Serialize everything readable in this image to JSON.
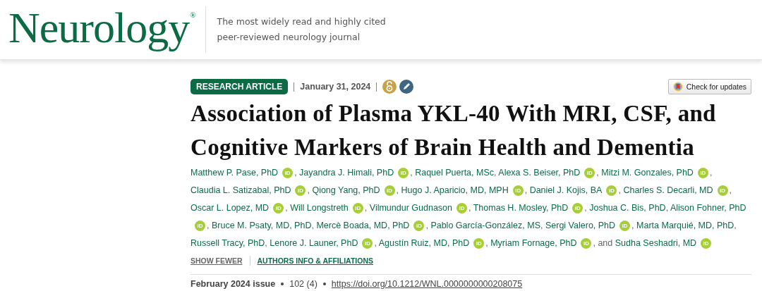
{
  "header": {
    "logo": "Neurology",
    "registered_mark": "®",
    "tagline": "The most widely read and highly cited peer-reviewed neurology journal"
  },
  "article": {
    "badge": "RESEARCH ARTICLE",
    "date": "January 31, 2024",
    "open_access": true,
    "editorial": true,
    "updates_button": "Check for updates",
    "title": "Association of Plasma YKL-40 With MRI, CSF, and Cognitive Markers of Brain Health and Dementia",
    "authors": [
      {
        "name": "Matthew P. Pase, PhD",
        "orcid": "iD",
        "sep": ","
      },
      {
        "name": "Jayandra J. Himali, PhD",
        "orcid": "iD",
        "sep": ","
      },
      {
        "name": "Raquel Puerta, MSc",
        "sep": ","
      },
      {
        "name": "Alexa S. Beiser, PhD",
        "orcid": "iD",
        "sep": ","
      },
      {
        "name": "Mitzi M. Gonzales, PhD",
        "orcid": "iD",
        "sep": ","
      },
      {
        "name": "Claudia L. Satizabal, PhD",
        "orcid": "iD",
        "sep": ","
      },
      {
        "name": "Qiong Yang, PhD",
        "orcid": "iD",
        "sep": ","
      },
      {
        "name": "Hugo J. Aparicio, MD, MPH",
        "orcid": "iD",
        "sep": ","
      },
      {
        "name": "Daniel J. Kojis, BA",
        "orcid": "iD",
        "sep": ","
      },
      {
        "name": "Charles S. Decarli, MD",
        "orcid": "iD",
        "sep": ","
      },
      {
        "name": "Oscar L. Lopez, MD",
        "orcid": "iD",
        "sep": ","
      },
      {
        "name": "Will Longstreth",
        "orcid": "iD",
        "sep": ","
      },
      {
        "name": "Vilmundur Gudnason",
        "orcid": "iD",
        "sep": ","
      },
      {
        "name": "Thomas H. Mosley, PhD",
        "orcid": "iD",
        "sep": ","
      },
      {
        "name": "Joshua C. Bis, PhD",
        "sep": ","
      },
      {
        "name": "Alison Fohner, PhD",
        "orcid": "iD",
        "sep": ","
      },
      {
        "name": "Bruce M. Psaty, MD, PhD",
        "sep": ","
      },
      {
        "name": "Mercè Boada, MD, PhD",
        "orcid": "iD",
        "sep": ","
      },
      {
        "name": "Pablo García-González, MS",
        "sep": ","
      },
      {
        "name": "Sergi Valero, PhD",
        "orcid": "iD",
        "sep": ","
      },
      {
        "name": "Marta Marquié, MD, PhD",
        "sep": ","
      },
      {
        "name": "Russell Tracy, PhD",
        "sep": ","
      },
      {
        "name": "Lenore J. Launer, PhD",
        "orcid": "iD",
        "sep": ","
      },
      {
        "name": "Agustín Ruiz, MD, PhD",
        "orcid": "iD",
        "sep": ","
      },
      {
        "name": "Myriam Fornage, PhD",
        "orcid": "iD",
        "sep": ", and"
      },
      {
        "name": "Sudha Seshadri, MD",
        "orcid": "iD"
      }
    ],
    "show_fewer": "SHOW FEWER",
    "affiliations": "AUTHORS INFO & AFFILIATIONS",
    "issue": "February 2024 issue",
    "volume": "102",
    "number": "(4)",
    "doi": "https://doi.org/10.1212/WNL.0000000000208075"
  }
}
